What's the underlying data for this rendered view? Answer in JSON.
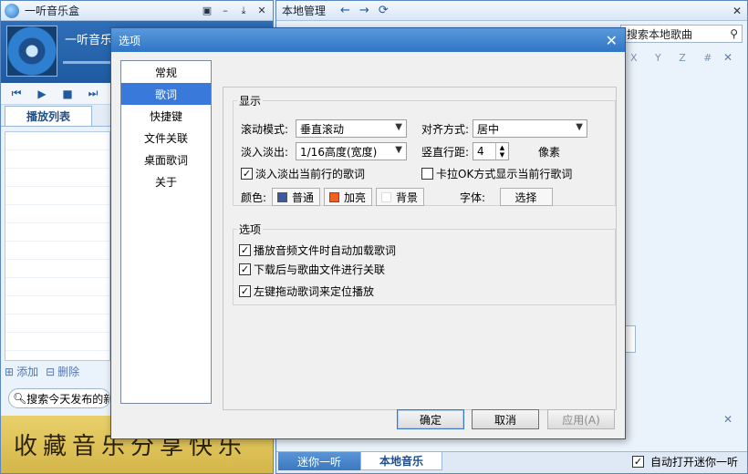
{
  "player": {
    "title": "一听音乐盒",
    "now_playing": "一听音乐盒",
    "tab": "播放列表",
    "add": "添加",
    "delete": "删除",
    "search_placeholder": "搜索今天发布的新",
    "banner": "收藏音乐分享快乐"
  },
  "library": {
    "title": "本地管理",
    "search_placeholder": "搜索本地歌曲",
    "alpha_index": "X Y Z #",
    "tabs": [
      "迷你一听",
      "本地音乐"
    ],
    "auto_open": "自动打开迷你一听",
    "auto_open_checked": true
  },
  "dialog": {
    "title": "选项",
    "nav": [
      "常规",
      "歌词",
      "快捷键",
      "文件关联",
      "桌面歌词",
      "关于"
    ],
    "selected_nav": "歌词",
    "display": {
      "legend": "显示",
      "scroll_mode_label": "滚动模式:",
      "scroll_mode_value": "垂直滚动",
      "align_label": "对齐方式:",
      "align_value": "居中",
      "fade_label": "淡入淡出:",
      "fade_value": "1/16高度(宽度)",
      "line_spacing_label": "竖直行距:",
      "line_spacing_value": "4",
      "line_spacing_unit": "像素",
      "fade_current_label": "淡入淡出当前行的歌词",
      "fade_current_checked": true,
      "karaoke_label": "卡拉OK方式显示当前行歌词",
      "karaoke_checked": false,
      "color_label": "颜色:",
      "color_normal": "普通",
      "color_normal_hex": "#3b5b9a",
      "color_highlight": "加亮",
      "color_highlight_hex": "#f06020",
      "color_background": "背景",
      "color_background_hex": "#ffffff",
      "font_label": "字体:",
      "font_button": "选择"
    },
    "options": {
      "legend": "选项",
      "items": [
        {
          "label": "播放音频文件时自动加载歌词",
          "checked": true
        },
        {
          "label": "下载后与歌曲文件进行关联",
          "checked": true
        },
        {
          "label": "左键拖动歌词来定位播放",
          "checked": true
        }
      ]
    },
    "buttons": {
      "ok": "确定",
      "cancel": "取消",
      "apply": "应用(A)"
    }
  }
}
